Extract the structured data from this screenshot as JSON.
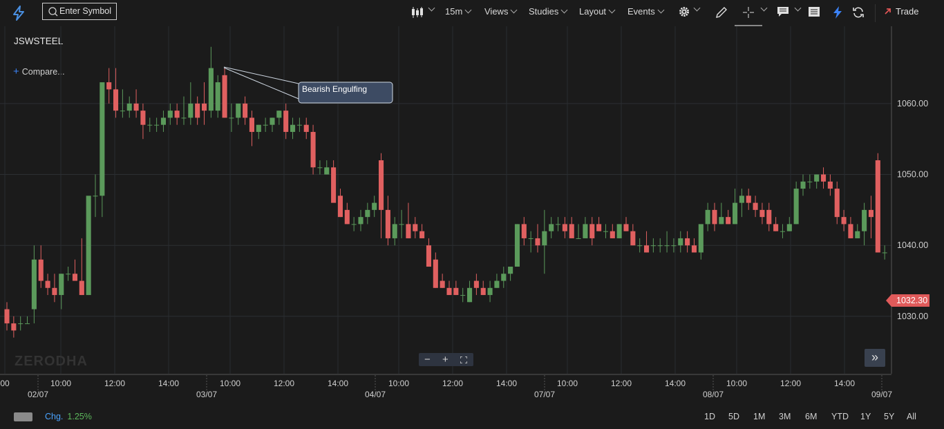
{
  "toolbar": {
    "search_placeholder": "Enter Symbol",
    "interval": "15m",
    "views": "Views",
    "studies": "Studies",
    "layout": "Layout",
    "events": "Events",
    "trade": "Trade"
  },
  "symbol": "JSWSTEEL",
  "compare_label": "Compare...",
  "watermark": "ZERODHA",
  "footer": {
    "chg_label": "Chg.",
    "chg_value": "1.25%",
    "ranges": [
      "1D",
      "5D",
      "1M",
      "3M",
      "6M",
      "YTD",
      "1Y",
      "5Y",
      "All"
    ]
  },
  "chart_data": {
    "type": "candlestick",
    "interval": "15m",
    "y_ticks": [
      "1030.00",
      "1040.00",
      "1050.00",
      "1060.00"
    ],
    "ylim": [
      1021.9,
      1070.9
    ],
    "last_price": "1032.30",
    "annotation": "Bearish Engulfing",
    "x_time_labels": [
      "00",
      "10:00",
      "12:00",
      "14:00",
      "10:00",
      "12:00",
      "14:00",
      "10:00",
      "12:00",
      "14:00",
      "10:00",
      "12:00",
      "14:00",
      "10:00",
      "12:00",
      "14:00"
    ],
    "x_date_labels": [
      "02/07",
      "03/07",
      "04/07",
      "07/07",
      "08/07",
      "09/07"
    ],
    "candles": [
      [
        1031,
        1032,
        1028,
        1029
      ],
      [
        1029,
        1030,
        1027,
        1028
      ],
      [
        1029,
        1030,
        1028,
        1029
      ],
      [
        1029,
        1030,
        1029,
        1029
      ],
      [
        1031,
        1040,
        1029,
        1038
      ],
      [
        1038,
        1040,
        1034,
        1035
      ],
      [
        1035,
        1036,
        1033,
        1034
      ],
      [
        1034,
        1036,
        1032,
        1033
      ],
      [
        1033,
        1036,
        1031,
        1036
      ],
      [
        1036,
        1037,
        1035,
        1036
      ],
      [
        1036,
        1038,
        1035,
        1035
      ],
      [
        1035,
        1041,
        1033,
        1033
      ],
      [
        1033,
        1041,
        1033,
        1047
      ],
      [
        1047,
        1050,
        1044,
        1047
      ],
      [
        1047,
        1050,
        1044,
        1063
      ],
      [
        1063,
        1065,
        1060,
        1062
      ],
      [
        1062,
        1065,
        1058,
        1059
      ],
      [
        1059,
        1062,
        1058,
        1059
      ],
      [
        1059,
        1061,
        1058,
        1060
      ],
      [
        1060,
        1062,
        1058,
        1059
      ],
      [
        1059,
        1060,
        1055,
        1057
      ],
      [
        1057,
        1058,
        1056,
        1057
      ],
      [
        1057,
        1058,
        1056,
        1057
      ],
      [
        1057,
        1059,
        1056,
        1058
      ],
      [
        1058,
        1060,
        1057,
        1059
      ],
      [
        1059,
        1060,
        1057,
        1058
      ],
      [
        1058,
        1061,
        1057,
        1058
      ],
      [
        1058,
        1063,
        1057,
        1060
      ],
      [
        1060,
        1061,
        1057,
        1058
      ],
      [
        1060,
        1063,
        1057,
        1059
      ],
      [
        1059,
        1068,
        1058,
        1065
      ],
      [
        1059,
        1064,
        1058,
        1063
      ],
      [
        1064,
        1065,
        1058,
        1058
      ],
      [
        1058,
        1060,
        1056,
        1058
      ],
      [
        1058,
        1060,
        1057,
        1060
      ],
      [
        1060,
        1061,
        1057,
        1058
      ],
      [
        1058,
        1059,
        1054,
        1056
      ],
      [
        1056,
        1057,
        1055,
        1057
      ],
      [
        1057,
        1058,
        1056,
        1057
      ],
      [
        1057,
        1058,
        1056,
        1058
      ],
      [
        1058,
        1059,
        1057,
        1059
      ],
      [
        1059,
        1060,
        1055,
        1056
      ],
      [
        1056,
        1058,
        1055,
        1057
      ],
      [
        1057,
        1058,
        1056,
        1057
      ],
      [
        1057,
        1058,
        1055,
        1056
      ],
      [
        1056,
        1057,
        1050,
        1051
      ],
      [
        1051,
        1052,
        1050,
        1051
      ],
      [
        1050,
        1052,
        1050,
        1051
      ],
      [
        1051,
        1052,
        1048,
        1046
      ],
      [
        1047,
        1048,
        1044,
        1044
      ],
      [
        1045,
        1046,
        1043,
        1043
      ],
      [
        1043,
        1044,
        1042,
        1043
      ],
      [
        1043,
        1045,
        1042,
        1044
      ],
      [
        1044,
        1046,
        1043,
        1045
      ],
      [
        1045,
        1047,
        1044,
        1046
      ],
      [
        1052,
        1053,
        1041,
        1045
      ],
      [
        1045,
        1047,
        1040,
        1041
      ],
      [
        1041,
        1044,
        1040,
        1043
      ],
      [
        1043,
        1045,
        1041,
        1043
      ],
      [
        1043,
        1046,
        1041,
        1041
      ],
      [
        1043,
        1044,
        1041,
        1042
      ],
      [
        1042,
        1043,
        1041,
        1041
      ],
      [
        1040,
        1041,
        1037,
        1037
      ],
      [
        1038,
        1039,
        1034,
        1034
      ],
      [
        1035,
        1036,
        1034,
        1034
      ],
      [
        1034,
        1035,
        1033,
        1033
      ],
      [
        1034,
        1035,
        1033,
        1033
      ],
      [
        1033,
        1034,
        1032,
        1033
      ],
      [
        1032,
        1035,
        1032,
        1034
      ],
      [
        1035,
        1036,
        1033,
        1034
      ],
      [
        1034,
        1035,
        1033,
        1033
      ],
      [
        1033,
        1035,
        1032,
        1034
      ],
      [
        1034,
        1036,
        1034,
        1035
      ],
      [
        1035,
        1037,
        1034,
        1036
      ],
      [
        1036,
        1037,
        1035,
        1037
      ],
      [
        1037,
        1043,
        1037,
        1043
      ],
      [
        1043,
        1044,
        1040,
        1041
      ],
      [
        1041,
        1042,
        1039,
        1041
      ],
      [
        1041,
        1043,
        1039,
        1040
      ],
      [
        1040,
        1045,
        1036,
        1042
      ],
      [
        1042,
        1044,
        1041,
        1043
      ],
      [
        1043,
        1044,
        1042,
        1043
      ],
      [
        1043,
        1044,
        1041,
        1042
      ],
      [
        1043,
        1044,
        1041,
        1041
      ],
      [
        1041,
        1043,
        1041,
        1041
      ],
      [
        1041,
        1044,
        1041,
        1043
      ],
      [
        1043,
        1044,
        1040,
        1041
      ],
      [
        1043,
        1044,
        1042,
        1042
      ],
      [
        1042,
        1043,
        1041,
        1042
      ],
      [
        1042,
        1043,
        1041,
        1041
      ],
      [
        1041,
        1043,
        1041,
        1043
      ],
      [
        1043,
        1044,
        1042,
        1042
      ],
      [
        1042,
        1043,
        1040,
        1040
      ],
      [
        1040,
        1041,
        1039,
        1040
      ],
      [
        1040,
        1042,
        1039,
        1039
      ],
      [
        1040,
        1041,
        1039,
        1040
      ],
      [
        1040,
        1041,
        1039,
        1040
      ],
      [
        1040,
        1042,
        1039,
        1040
      ],
      [
        1040,
        1041,
        1039,
        1040
      ],
      [
        1040,
        1042,
        1039,
        1041
      ],
      [
        1041,
        1042,
        1039,
        1040
      ],
      [
        1040,
        1041,
        1039,
        1039
      ],
      [
        1039,
        1042,
        1038,
        1043
      ],
      [
        1043,
        1046,
        1042,
        1045
      ],
      [
        1045,
        1046,
        1042,
        1043
      ],
      [
        1043,
        1046,
        1043,
        1044
      ],
      [
        1044,
        1045,
        1043,
        1043
      ],
      [
        1043,
        1048,
        1043,
        1046
      ],
      [
        1046,
        1048,
        1044,
        1047
      ],
      [
        1047,
        1048,
        1045,
        1046
      ],
      [
        1046,
        1047,
        1044,
        1045
      ],
      [
        1045,
        1046,
        1043,
        1044
      ],
      [
        1045,
        1046,
        1042,
        1043
      ],
      [
        1043,
        1044,
        1042,
        1042
      ],
      [
        1042,
        1043,
        1041,
        1042
      ],
      [
        1042,
        1044,
        1042,
        1043
      ],
      [
        1043,
        1049,
        1043,
        1048
      ],
      [
        1048,
        1050,
        1047,
        1049
      ],
      [
        1049,
        1050,
        1048,
        1049
      ],
      [
        1049,
        1050,
        1048,
        1050
      ],
      [
        1050,
        1051,
        1048,
        1049
      ],
      [
        1049,
        1050,
        1047,
        1048
      ],
      [
        1048,
        1049,
        1043,
        1044
      ],
      [
        1044,
        1045,
        1042,
        1043
      ],
      [
        1043,
        1044,
        1041,
        1041
      ],
      [
        1041,
        1043,
        1041,
        1042
      ],
      [
        1042,
        1046,
        1040,
        1045
      ],
      [
        1045,
        1047,
        1041,
        1044
      ],
      [
        1052,
        1053,
        1039,
        1039
      ],
      [
        1039,
        1040,
        1038,
        1039
      ]
    ]
  }
}
